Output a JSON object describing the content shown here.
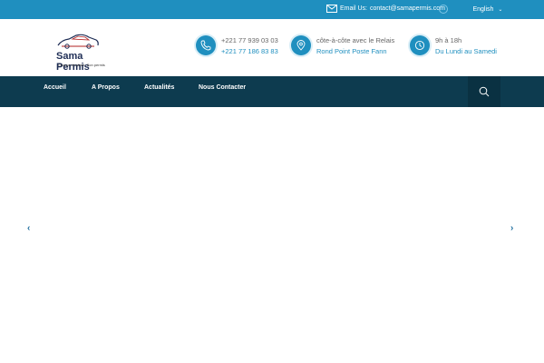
{
  "topbar": {
    "email_label": "Email Us:",
    "email_value": "contact@samapermis.com",
    "language": "English"
  },
  "logo": {
    "brand": "Sama Permis",
    "tagline": "Chaque étudiant, Son permis"
  },
  "contact": {
    "phone1": "+221 77 939 03 03",
    "phone2": "+221 77 186 83 83",
    "address1": "côte-à-côte avec le Relais",
    "address2": "Rond Point Poste Fann",
    "hours1": "9h à 18h",
    "hours2": "Du Lundi au Samedi"
  },
  "nav": {
    "items": [
      {
        "label": "Accueil"
      },
      {
        "label": "A Propos"
      },
      {
        "label": "Actualités"
      },
      {
        "label": "Nous Contacter"
      }
    ]
  },
  "slider": {
    "prev": "‹",
    "next": "›"
  },
  "colors": {
    "topbar": "#1f8fbf",
    "nav": "#0d3b4f",
    "accent": "#1f8fbf",
    "brand": "#1e2d55"
  },
  "icons": [
    "envelope-icon",
    "globe-icon",
    "chevron-down-icon",
    "phone-icon",
    "location-pin-icon",
    "clock-icon",
    "search-icon",
    "arrow-left-icon",
    "arrow-right-icon"
  ]
}
